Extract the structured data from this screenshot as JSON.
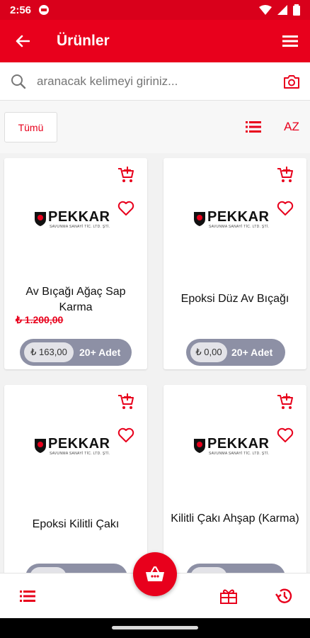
{
  "status_bar": {
    "time": "2:56"
  },
  "app_bar": {
    "title": "Ürünler"
  },
  "search": {
    "placeholder": "aranacak kelimeyi giriniz..."
  },
  "filters": {
    "all_label": "Tümü",
    "sort_label": "AZ"
  },
  "products": [
    {
      "name": "Av Bıçağı Ağaç Sap Karma",
      "old_price": "₺ 1.200,00",
      "price": "₺ 163,00",
      "qty": "20+ Adet"
    },
    {
      "name": "Epoksi Düz Av Bıçağı",
      "price": "₺ 0,00",
      "qty": "20+ Adet"
    },
    {
      "name": "Epoksi Kilitli Çakı"
    },
    {
      "name": "Kilitli Çakı Ahşap (Karma)"
    }
  ],
  "logo": {
    "brand": "PEKKAR",
    "sub": "SAVUNMA SANAYİ TİC. LTD. ŞTİ."
  },
  "colors": {
    "primary": "#e8001c",
    "pill": "#8d90a5"
  },
  "icons": [
    "back-arrow-icon",
    "menu-icon",
    "search-icon",
    "camera-icon",
    "list-icon",
    "add-cart-icon",
    "heart-icon",
    "basket-icon",
    "gift-icon",
    "history-icon"
  ]
}
